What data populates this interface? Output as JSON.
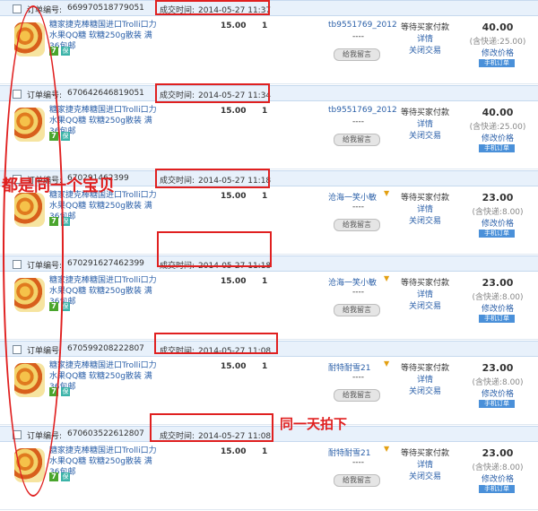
{
  "labels": {
    "order_no": "订单编号:",
    "deal_time": "成交时间:",
    "status": "等待买家付款",
    "detail": "详情",
    "close": "关闭交易",
    "modify": "修改价格",
    "mobile": "手机订单",
    "leave_msg": "给我留言",
    "dash": "----",
    "product_title": "糖家捷克棒糖国进口Trolli口力水果QQ糖 软糖250g散装 满36包邮",
    "badge7": "7",
    "badge_b": "保"
  },
  "colors": {
    "link": "#2a5fa8",
    "header_bg": "#e8f1fb",
    "annotation": "#e02020"
  },
  "orders": [
    {
      "no": "669970518779051",
      "time": "2014-05-27 11:37",
      "price": "15.00",
      "qty": "1",
      "buyer": "tb9551769_2012",
      "has_flag": false,
      "total": "40.00",
      "ship": "(含快递:25.00)"
    },
    {
      "no": "670642646819051",
      "time": "2014-05-27 11:34",
      "price": "15.00",
      "qty": "1",
      "buyer": "tb9551769_2012",
      "has_flag": false,
      "total": "40.00",
      "ship": "(含快递:25.00)"
    },
    {
      "no": "670291462399",
      "time": "2014-05-27 11:18",
      "price": "15.00",
      "qty": "1",
      "buyer": "沧海一笑小敏",
      "has_flag": true,
      "total": "23.00",
      "ship": "(含快递:8.00)"
    },
    {
      "no": "670291627462399",
      "time": "2014-05-27 11:18",
      "price": "15.00",
      "qty": "1",
      "buyer": "沧海一笑小敏",
      "has_flag": true,
      "total": "23.00",
      "ship": "(含快递:8.00)"
    },
    {
      "no": "670599208222807",
      "time": "2014-05-27 11:08",
      "price": "15.00",
      "qty": "1",
      "buyer": "耐特耐雪21",
      "has_flag": true,
      "total": "23.00",
      "ship": "(含快递:8.00)"
    },
    {
      "no": "670603522612807",
      "time": "2014-05-27 11:08",
      "price": "15.00",
      "qty": "1",
      "buyer": "耐特耐雪21",
      "has_flag": true,
      "total": "23.00",
      "ship": "(含快递:8.00)"
    }
  ],
  "annotations": {
    "same_item": "都是同一个宝贝",
    "same_day": "同一天拍下"
  }
}
